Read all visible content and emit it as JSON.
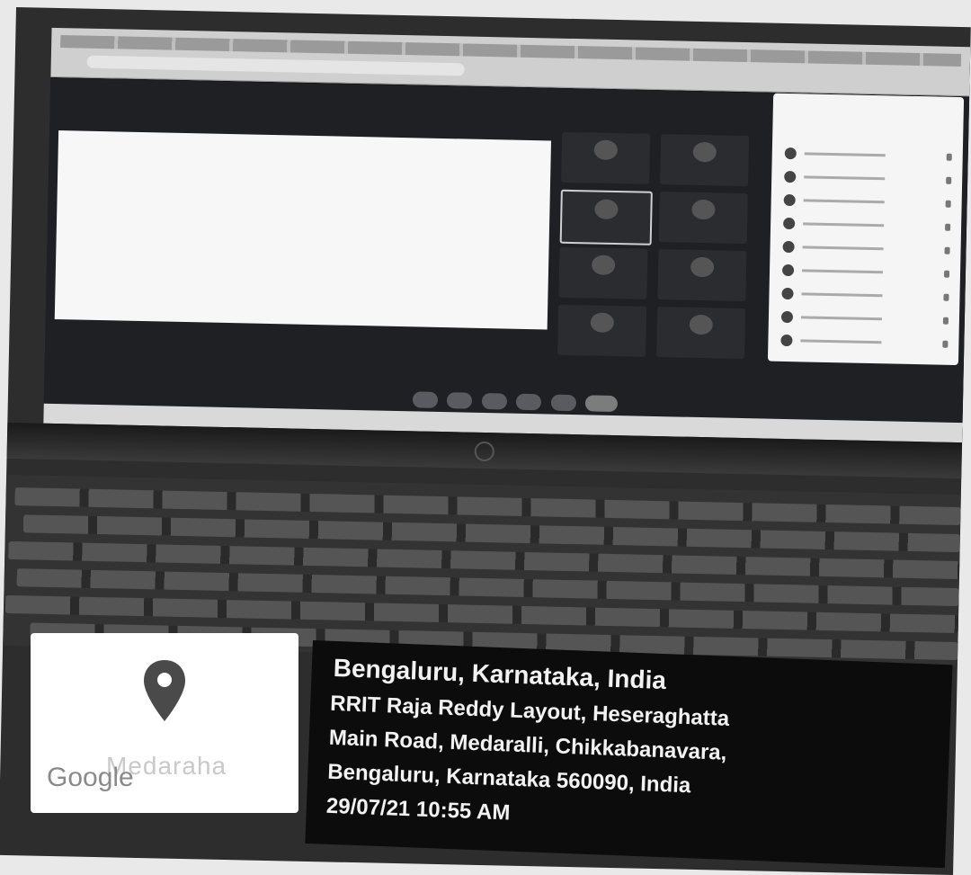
{
  "stamp": {
    "city": "Bengaluru, Karnataka, India",
    "address_lines": [
      "RRIT Raja Reddy Layout, Heseraghatta",
      "Main Road, Medaralli, Chikkabanavara,",
      "Bengaluru, Karnataka 560090, India"
    ],
    "datetime": "29/07/21 10:55 AM",
    "map_label": "Medaraha",
    "map_logo": "Google"
  },
  "icons": {
    "pin": "map-pin-icon"
  },
  "colors": {
    "pin": "#4a4a4a",
    "stamp_bg": "#0c0c0c",
    "stamp_text": "#f2f2f2"
  }
}
